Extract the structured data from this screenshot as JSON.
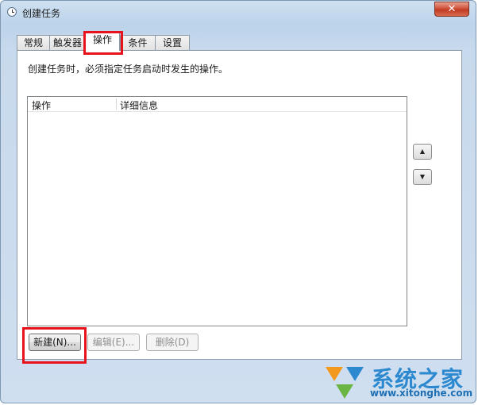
{
  "window": {
    "title": "创建任务",
    "close_glyph": "✕"
  },
  "tabs": [
    {
      "label": "常规"
    },
    {
      "label": "触发器"
    },
    {
      "label": "操作"
    },
    {
      "label": "条件"
    },
    {
      "label": "设置"
    }
  ],
  "panel": {
    "description": "创建任务时，必须指定任务启动时发生的操作。",
    "columns": [
      "操作",
      "详细信息"
    ]
  },
  "scroll": {
    "up_glyph": "▲",
    "down_glyph": "▼"
  },
  "buttons": {
    "new": "新建(N)...",
    "edit": "编辑(E)...",
    "delete": "删除(D)"
  },
  "watermark": {
    "brand": "系统之家",
    "url": "www.xitonghe.com"
  },
  "colors": {
    "highlight": "#e8121c",
    "title_bar": "#bcd3ea",
    "close_button": "#c23a22"
  }
}
